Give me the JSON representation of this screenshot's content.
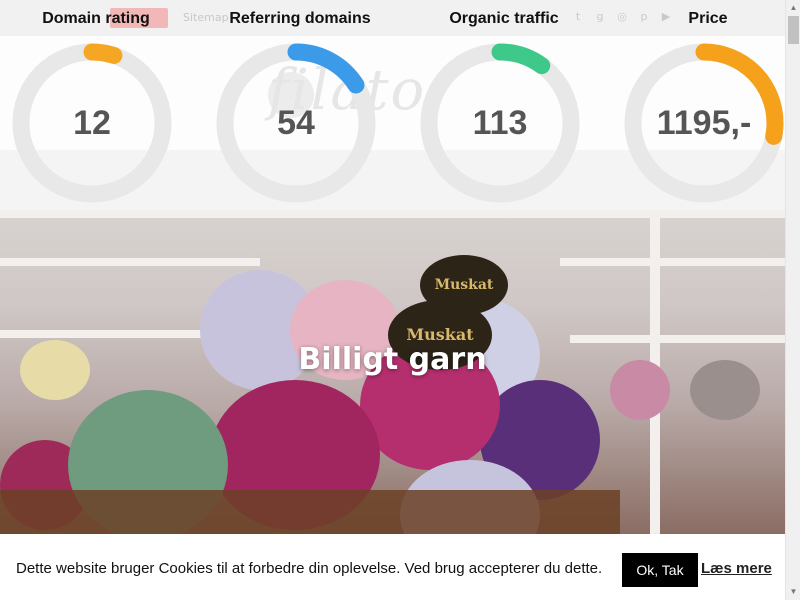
{
  "site": {
    "topbar_text": "Sitemap",
    "logo_text": "filato",
    "social_icons": [
      "twitter-icon",
      "google-plus-icon",
      "instagram-icon",
      "pinterest-icon",
      "youtube-icon"
    ]
  },
  "metrics": [
    {
      "label": "Domain rating",
      "value": "12",
      "fraction": 0.05,
      "color": "#f5a623"
    },
    {
      "label": "Referring domains",
      "value": "54",
      "fraction": 0.16,
      "color": "#3b9be8"
    },
    {
      "label": "Organic traffic",
      "value": "113",
      "fraction": 0.1,
      "color": "#3ec98a"
    },
    {
      "label": "Price",
      "value": "1195,-",
      "fraction": 0.28,
      "color": "#f5a11c"
    }
  ],
  "hero": {
    "title": "Billigt garn",
    "tag_text": "Muskat"
  },
  "cookie": {
    "message": "Dette website bruger Cookies til at forbedre din oplevelse. Ved brug accepterer du dette.",
    "ok_label": "Ok, Tak",
    "more_label": "Læs mere"
  },
  "colors": {
    "gauge_track": "#e8e8e8"
  }
}
